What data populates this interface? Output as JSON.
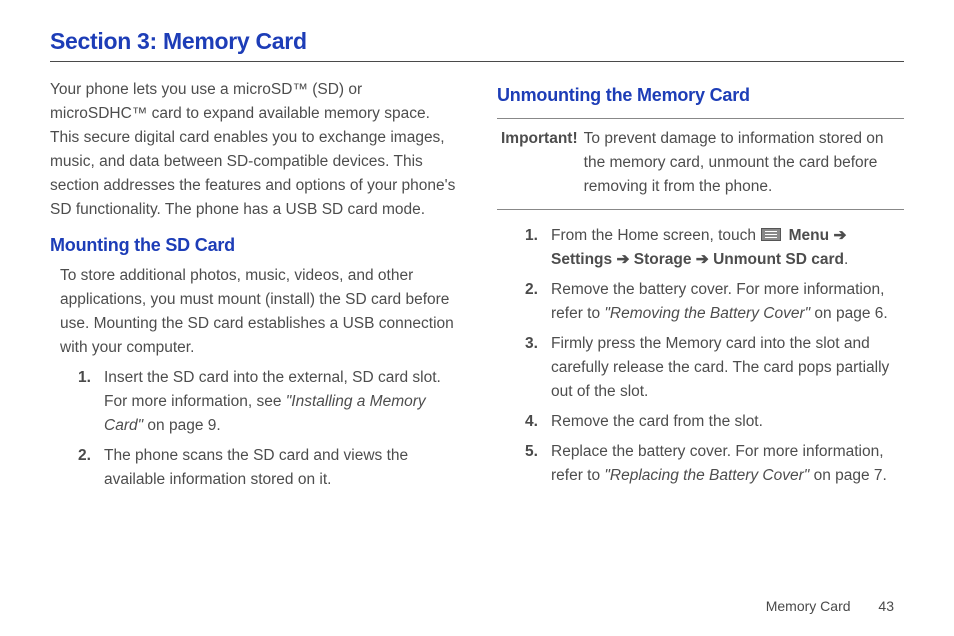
{
  "section_title": "Section 3: Memory Card",
  "left": {
    "intro": "Your phone lets you use a microSD™ (SD) or microSDHC™ card to expand available memory space. This secure digital card enables you to exchange images, music, and data between SD-compatible devices. This section addresses the features and options of your phone's SD functionality. The phone has a USB SD card mode.",
    "sub1_title": "Mounting the SD Card",
    "sub1_intro": "To store additional photos, music, videos, and other applications, you must mount (install) the SD card before use. Mounting the SD card establishes a USB connection with your computer.",
    "step1_a": "Insert the SD card into the external, SD card slot. For more information, see ",
    "step1_xref": "\"Installing a Memory Card\"",
    "step1_b": " on page 9.",
    "step2": "The phone scans the SD card and views the available information stored on it."
  },
  "right": {
    "sub2_title": "Unmounting the Memory Card",
    "important_label": "Important!",
    "important_text": "To prevent damage to information stored on the memory card, unmount the card before removing it from the phone.",
    "r1_a": "From the Home screen, touch ",
    "r1_menu": " Menu ",
    "r1_arrow1": "➔",
    "r1_settings": "Settings ",
    "r1_arrow2": "➔",
    "r1_storage": " Storage ",
    "r1_arrow3": "➔",
    "r1_unmount": " Unmount SD card",
    "r1_end": ".",
    "r2_a": "Remove the battery cover. For more information, refer to ",
    "r2_xref": "\"Removing the Battery Cover\"",
    "r2_b": " on page 6.",
    "r3": "Firmly press the Memory card into the slot and carefully release the card. The card pops partially out of the slot.",
    "r4": "Remove the card from the slot.",
    "r5_a": "Replace the battery cover. For more information, refer to ",
    "r5_xref": "\"Replacing the Battery Cover\"",
    "r5_b": " on page 7."
  },
  "footer": {
    "label": "Memory Card",
    "page": "43"
  }
}
